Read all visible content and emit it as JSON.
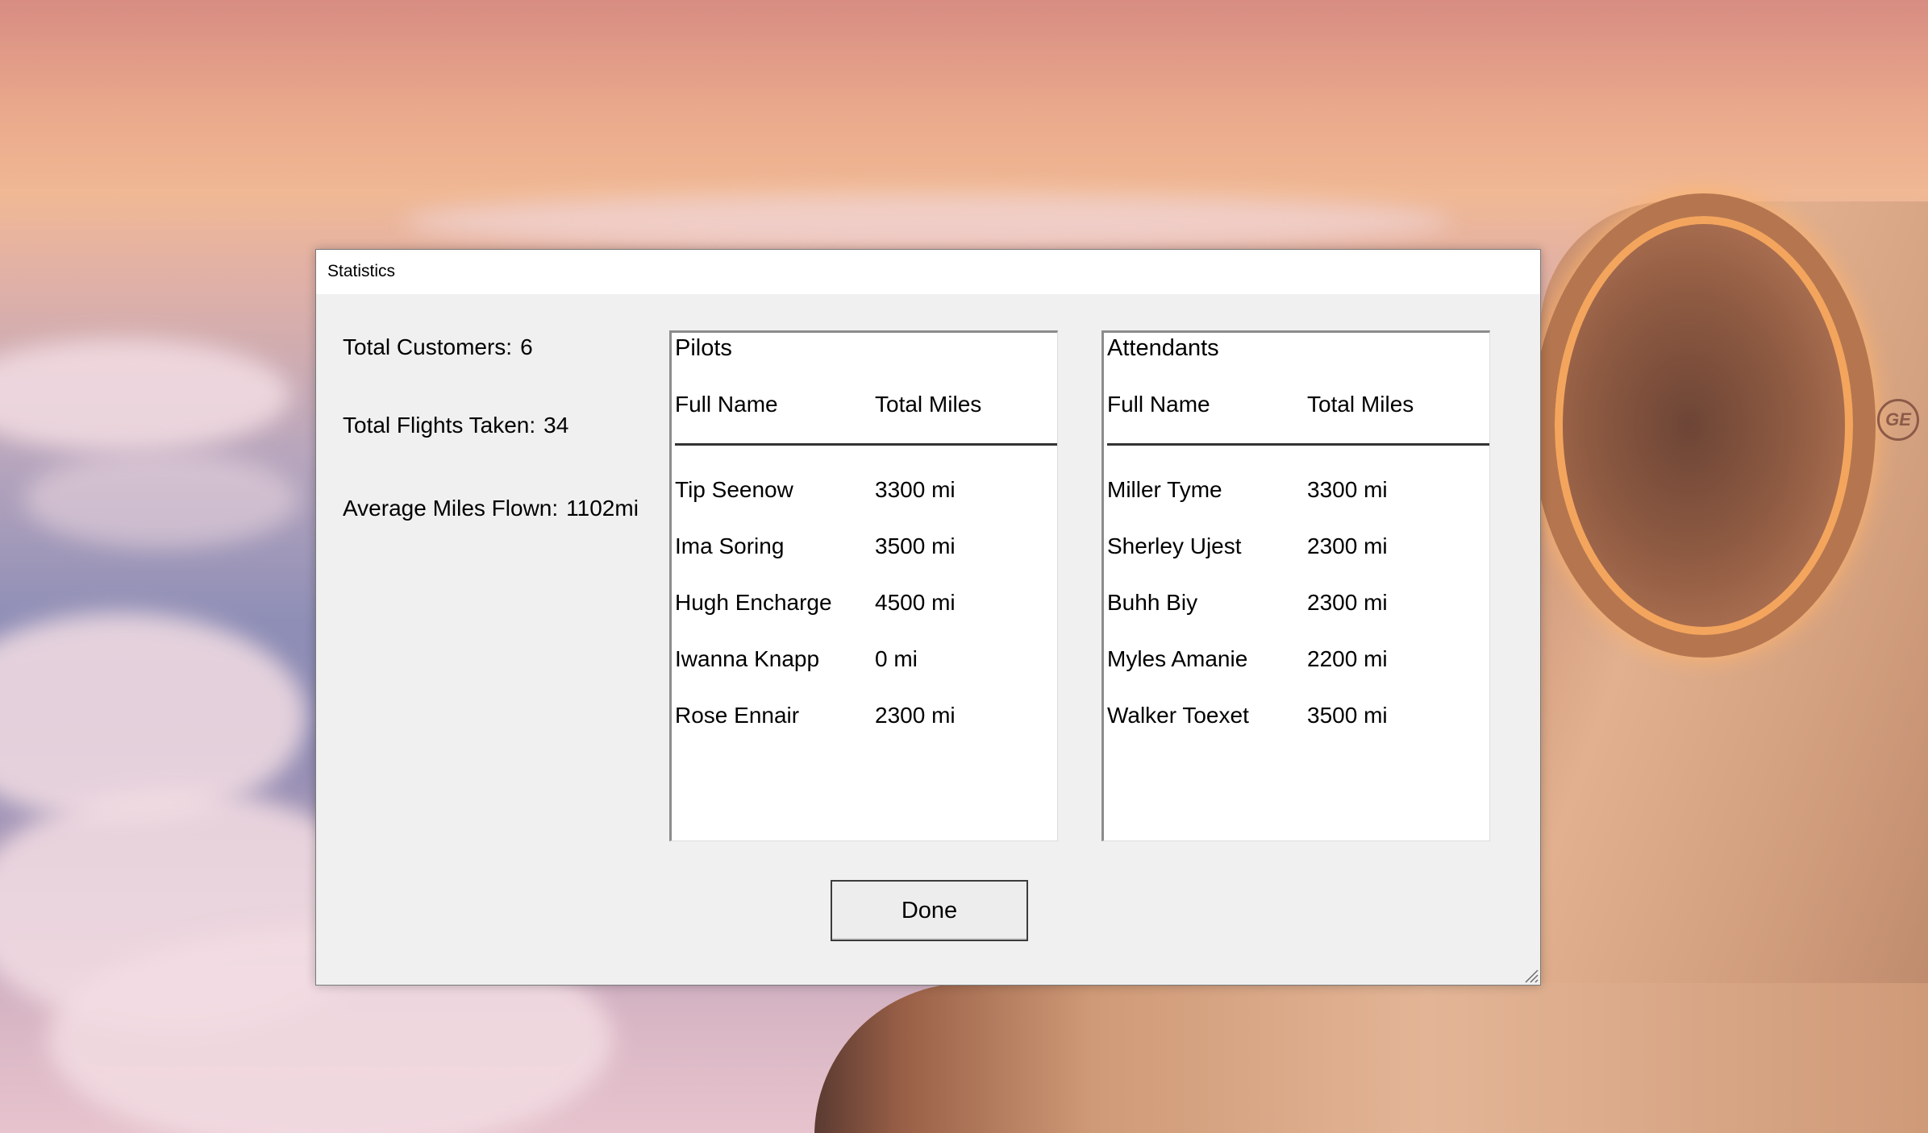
{
  "window": {
    "title": "Statistics"
  },
  "stats": {
    "total_customers_label": "Total Customers:",
    "total_customers": "6",
    "total_flights_label": "Total Flights Taken:",
    "total_flights": "34",
    "avg_miles_label": "Average Miles Flown:",
    "avg_miles": "1102mi"
  },
  "pilots": {
    "title": "Pilots",
    "col_name": "Full Name",
    "col_miles": "Total Miles",
    "rows": [
      {
        "name": "Tip Seenow",
        "miles": "3300 mi"
      },
      {
        "name": "Ima Soring",
        "miles": "3500 mi"
      },
      {
        "name": "Hugh Encharge",
        "miles": "4500 mi"
      },
      {
        "name": "Iwanna Knapp",
        "miles": "0 mi"
      },
      {
        "name": "Rose Ennair",
        "miles": "2300 mi"
      }
    ]
  },
  "attendants": {
    "title": "Attendants",
    "col_name": "Full Name",
    "col_miles": "Total Miles",
    "rows": [
      {
        "name": "Miller Tyme",
        "miles": "3300 mi"
      },
      {
        "name": "Sherley Ujest",
        "miles": "2300 mi"
      },
      {
        "name": "Buhh Biy",
        "miles": "2300 mi"
      },
      {
        "name": "Myles Amanie",
        "miles": "2200 mi"
      },
      {
        "name": "Walker Toexet",
        "miles": "3500 mi"
      }
    ]
  },
  "buttons": {
    "done": "Done"
  },
  "background": {
    "description_colors": [
      "#d78d82",
      "#f0b894",
      "#8e8eb6",
      "#e6c3cd"
    ],
    "engine_logo": "GE"
  }
}
